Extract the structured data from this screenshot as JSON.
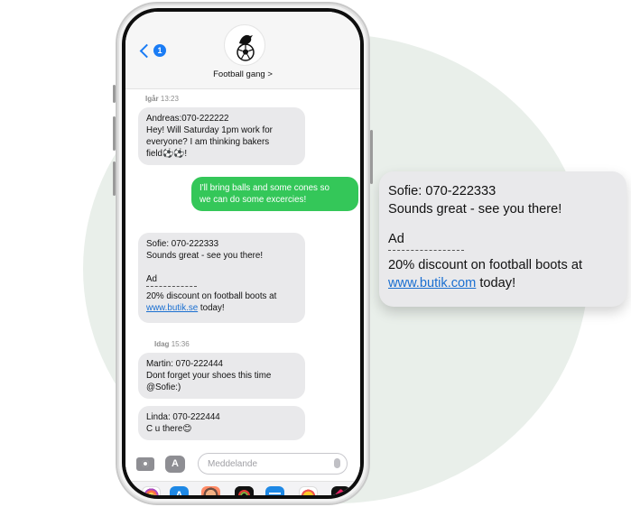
{
  "header": {
    "back_badge": "1",
    "contact_name": "Football gang >"
  },
  "conversation": [
    {
      "kind": "timestamp",
      "day": "Igår",
      "time": "13:23"
    },
    {
      "kind": "incoming",
      "lines": [
        "Andreas:070-222222",
        "Hey! Will Saturday 1pm work for",
        "everyone? I am thinking bakers",
        "field⚽⚽!"
      ]
    },
    {
      "kind": "outgoing",
      "lines": [
        "I'll bring balls and some cones so",
        "we can do some excercies!"
      ]
    },
    {
      "kind": "incoming_ad",
      "lines": [
        "Sofie: 070-222333",
        "Sounds great - see you there!"
      ],
      "ad_label": "Ad",
      "ad_text": "20% discount on football boots at",
      "link": "www.butik.se",
      "link_suffix": " today!"
    },
    {
      "kind": "timestamp",
      "day": "Idag",
      "time": "15:36"
    },
    {
      "kind": "incoming",
      "lines": [
        "Martin: 070-222444",
        "Dont forget your shoes this time",
        "@Sofie:)"
      ]
    },
    {
      "kind": "incoming",
      "lines": [
        "Linda: 070-222444",
        "C u there😊"
      ]
    }
  ],
  "input": {
    "placeholder": "Meddelande",
    "camera_icon": "camera-icon",
    "apps_icon": "app-store-icon",
    "mic_icon": "microphone-icon"
  },
  "app_strip": [
    "photos-icon",
    "app-store-icon",
    "memoji-icon",
    "activity-icon",
    "audio-icon",
    "animoji-icon",
    "heart-icon"
  ],
  "zoom_card": {
    "lines": [
      "Sofie: 070-222333",
      "Sounds great - see you there!"
    ],
    "ad_label": "Ad",
    "ad_text": "20% discount on football boots at",
    "link": "www.butik.com",
    "link_suffix": " today!"
  },
  "colors": {
    "outgoing": "#34c759",
    "incoming": "#e9e9eb",
    "accent": "#1a7cf5",
    "link": "#1a6fd1",
    "background_blob": "#e9efea"
  }
}
